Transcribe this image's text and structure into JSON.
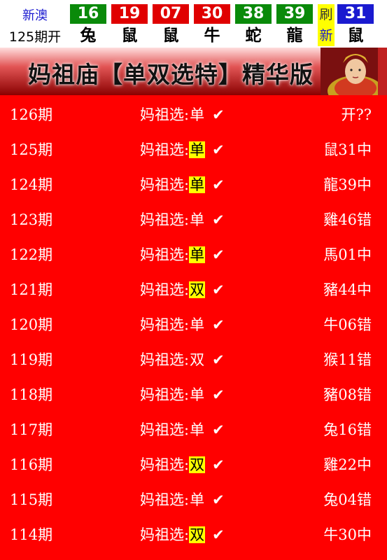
{
  "header": {
    "region_label": "新澳",
    "period_label": "125期开",
    "balls": [
      {
        "number": "16",
        "zodiac": "兔",
        "color": "#0a8a0a"
      },
      {
        "number": "19",
        "zodiac": "鼠",
        "color": "#e00000"
      },
      {
        "number": "07",
        "zodiac": "鼠",
        "color": "#e00000"
      },
      {
        "number": "30",
        "zodiac": "牛",
        "color": "#e00000"
      },
      {
        "number": "38",
        "zodiac": "蛇",
        "color": "#0a8a0a"
      },
      {
        "number": "39",
        "zodiac": "龍",
        "color": "#0a8a0a"
      }
    ],
    "refresh_top": "刷",
    "refresh_bottom": "新",
    "special": {
      "number": "31",
      "zodiac": "鼠",
      "color": "#1a1ad0"
    }
  },
  "banner": {
    "title": "妈祖庙【单双选特】精华版"
  },
  "rows": [
    {
      "period": "126期",
      "label": "妈祖选:",
      "value": "单",
      "highlight": false,
      "check": "✔",
      "result": "开??"
    },
    {
      "period": "125期",
      "label": "妈祖选:",
      "value": "单",
      "highlight": true,
      "check": "✔",
      "result": "鼠31中"
    },
    {
      "period": "124期",
      "label": "妈祖选:",
      "value": "单",
      "highlight": true,
      "check": "✔",
      "result": "龍39中"
    },
    {
      "period": "123期",
      "label": "妈祖选:",
      "value": "单",
      "highlight": false,
      "check": "✔",
      "result": "雞46错"
    },
    {
      "period": "122期",
      "label": "妈祖选:",
      "value": "单",
      "highlight": true,
      "check": "✔",
      "result": "馬01中"
    },
    {
      "period": "121期",
      "label": "妈祖选:",
      "value": "双",
      "highlight": true,
      "check": "✔",
      "result": "豬44中"
    },
    {
      "period": "120期",
      "label": "妈祖选:",
      "value": "单",
      "highlight": false,
      "check": "✔",
      "result": "牛06错"
    },
    {
      "period": "119期",
      "label": "妈祖选:",
      "value": "双",
      "highlight": false,
      "check": "✔",
      "result": "猴11错"
    },
    {
      "period": "118期",
      "label": "妈祖选:",
      "value": "单",
      "highlight": false,
      "check": "✔",
      "result": "豬08错"
    },
    {
      "period": "117期",
      "label": "妈祖选:",
      "value": "单",
      "highlight": false,
      "check": "✔",
      "result": "兔16错"
    },
    {
      "period": "116期",
      "label": "妈祖选:",
      "value": "双",
      "highlight": true,
      "check": "✔",
      "result": "雞22中"
    },
    {
      "period": "115期",
      "label": "妈祖选:",
      "value": "单",
      "highlight": false,
      "check": "✔",
      "result": "兔04错"
    },
    {
      "period": "114期",
      "label": "妈祖选:",
      "value": "双",
      "highlight": true,
      "check": "✔",
      "result": "牛30中"
    }
  ]
}
